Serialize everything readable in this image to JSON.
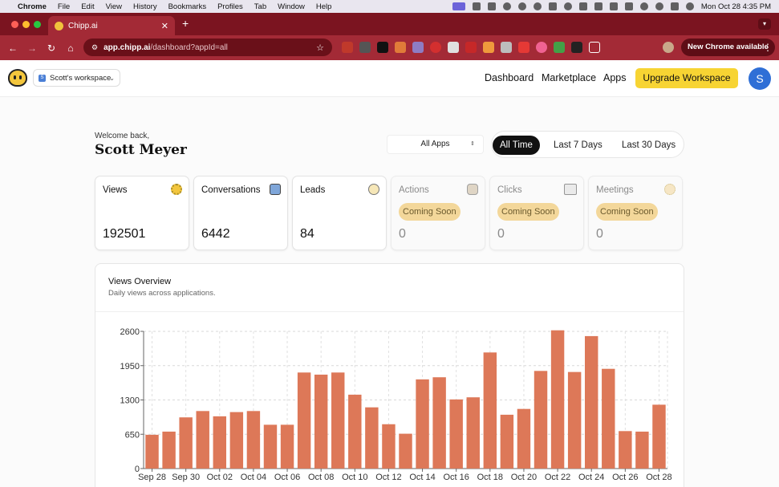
{
  "menubar": {
    "items": [
      "Chrome",
      "File",
      "Edit",
      "View",
      "History",
      "Bookmarks",
      "Profiles",
      "Tab",
      "Window",
      "Help"
    ],
    "clock": "Mon Oct 28  4:35 PM"
  },
  "browser": {
    "tab_title": "Chipp.ai",
    "url_host": "app.chipp.ai",
    "url_path": "/dashboard?appId=all",
    "new_chrome_label": "New Chrome available"
  },
  "header": {
    "workspace": "Scott's workspace",
    "workspace_badge": "S",
    "nav": [
      "Dashboard",
      "Marketplace",
      "Apps"
    ],
    "upgrade_label": "Upgrade Workspace",
    "avatar_initial": "S"
  },
  "greeting": {
    "welcome": "Welcome back,",
    "name": "Scott Meyer"
  },
  "filters": {
    "app_select": "All Apps",
    "time_ranges": [
      "All Time",
      "Last 7 Days",
      "Last 30 Days"
    ],
    "active_range": "All Time"
  },
  "stats": [
    {
      "label": "Views",
      "value": "192501",
      "icon": "sun-icon"
    },
    {
      "label": "Conversations",
      "value": "6442",
      "icon": "chat-icon"
    },
    {
      "label": "Leads",
      "value": "84",
      "icon": "lightbulb-icon"
    },
    {
      "label": "Actions",
      "value": "0",
      "badge": "Coming Soon",
      "icon": "hand-icon"
    },
    {
      "label": "Clicks",
      "value": "0",
      "badge": "Coming Soon",
      "icon": "cube-icon"
    },
    {
      "label": "Meetings",
      "value": "0",
      "badge": "Coming Soon",
      "icon": "calendar-icon"
    }
  ],
  "chart": {
    "title": "Views Overview",
    "subtitle": "Daily views across applications."
  },
  "chart_data": {
    "type": "bar",
    "categories": [
      "Sep 28",
      "Sep 29",
      "Sep 30",
      "Oct 01",
      "Oct 02",
      "Oct 03",
      "Oct 04",
      "Oct 05",
      "Oct 06",
      "Oct 07",
      "Oct 08",
      "Oct 09",
      "Oct 10",
      "Oct 11",
      "Oct 12",
      "Oct 13",
      "Oct 14",
      "Oct 15",
      "Oct 16",
      "Oct 17",
      "Oct 18",
      "Oct 19",
      "Oct 20",
      "Oct 21",
      "Oct 22",
      "Oct 23",
      "Oct 24",
      "Oct 25",
      "Oct 26",
      "Oct 27",
      "Oct 28"
    ],
    "x_tick_labels": [
      "Sep 28",
      "Sep 30",
      "Oct 02",
      "Oct 04",
      "Oct 06",
      "Oct 08",
      "Oct 10",
      "Oct 12",
      "Oct 14",
      "Oct 16",
      "Oct 18",
      "Oct 20",
      "Oct 22",
      "Oct 24",
      "Oct 26",
      "Oct 28"
    ],
    "values": [
      640,
      700,
      970,
      1090,
      990,
      1070,
      1090,
      830,
      830,
      1820,
      1780,
      1820,
      1400,
      1160,
      840,
      660,
      1690,
      1730,
      1310,
      1350,
      2200,
      1020,
      1130,
      1850,
      2620,
      1830,
      2510,
      1890,
      710,
      700,
      1210
    ],
    "y_ticks": [
      0,
      650,
      1300,
      1950,
      2600
    ],
    "ylim": [
      0,
      2600
    ],
    "grid": true,
    "bar_color": "#dd7858"
  },
  "colors": {
    "accent_yellow": "#f7d433",
    "bar": "#dd7858",
    "browser_frame": "#a32a36"
  }
}
